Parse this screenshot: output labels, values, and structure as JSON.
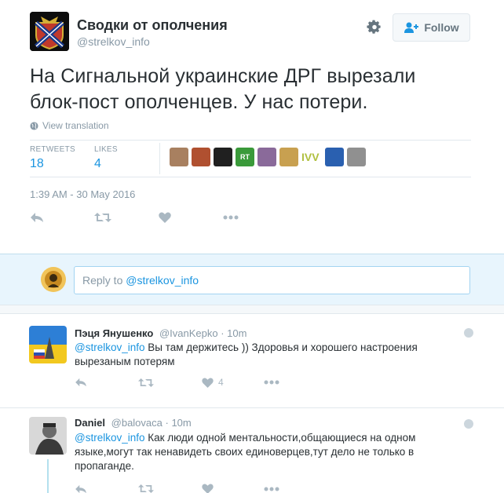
{
  "tweet": {
    "account_name": "Сводки от ополчения",
    "handle": "@strelkov_info",
    "follow_label": "Follow",
    "text_line1": "На Сигнальной украинские ДРГ вырезали",
    "text_line2": "блок-пост ополченцев. У нас потери.",
    "view_translation": "View translation",
    "retweets_label": "RETWEETS",
    "retweets_value": "18",
    "likes_label": "LIKES",
    "likes_value": "4",
    "liker_ivv": "IVV",
    "timestamp": "1:39 AM - 30 May 2016"
  },
  "reply_box": {
    "prefix": "Reply to ",
    "mention": "@strelkov_info"
  },
  "replies": [
    {
      "name": "Пэця Янушенко",
      "handle": "@IvanKepko",
      "time": "· 10m",
      "mention": "@strelkov_info",
      "text": " Вы там держитесь )) Здоровья и хорошего настроения вырезаным потерям",
      "likes": "4"
    },
    {
      "name": "Daniel",
      "handle": "@balovaca",
      "time": "· 10m",
      "mention": "@strelkov_info",
      "text": " Как люди одной ментальности,общающиеся на одном языке,могут так ненавидеть своих единоверцев,тут дело не только в пропаганде."
    }
  ],
  "colors": {
    "accent": "#1b95e0",
    "muted": "#8899a6",
    "reply_bg": "#e8f5fd"
  }
}
